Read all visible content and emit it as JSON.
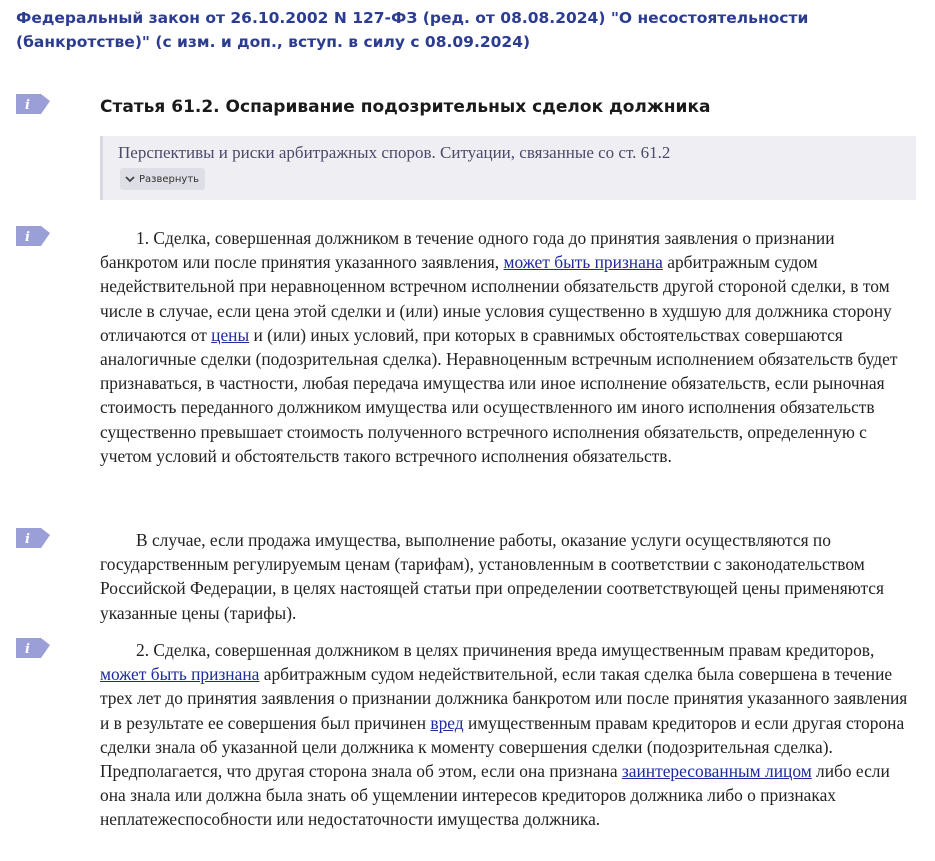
{
  "document": {
    "title": "Федеральный закон от 26.10.2002 N 127-ФЗ (ред. от 08.08.2024) \"О несостоятельности (банкротстве)\" (с изм. и доп., вступ. в силу с 08.09.2024)"
  },
  "colors": {
    "title": "#2b3c91",
    "link": "#1d2a9e",
    "icon": "#9b9fd8",
    "commentary_bg": "#efeff3"
  },
  "icons": {
    "paragraph_info": "info-icon",
    "expand": "chevron-down-icon"
  },
  "article": {
    "title": "Статья 61.2. Оспаривание подозрительных сделок должника"
  },
  "commentary": {
    "text": "Перспективы и риски арбитражных споров. Ситуации, связанные со ст. 61.2",
    "expand_label": "Развернуть"
  },
  "paragraphs": [
    {
      "t1": "1. Сделка, совершенная должником в течение одного года до принятия заявления о признании банкротом или после принятия указанного заявления, ",
      "link1": "может быть признана",
      "t2": " арбитражным судом недействительной при неравноценном встречном исполнении обязательств другой стороной сделки, в том числе в случае, если цена этой сделки и (или) иные условия существенно в худшую для должника сторону отличаются от ",
      "link2": "цены",
      "t3": " и (или) иных условий, при которых в сравнимых обстоятельствах совершаются аналогичные сделки (подозрительная сделка). Неравноценным встречным исполнением обязательств будет признаваться, в частности, любая передача имущества или иное исполнение обязательств, если рыночная стоимость переданного должником имущества или осуществленного им иного исполнения обязательств существенно превышает стоимость полученного встречного исполнения обязательств, определенную с учетом условий и обстоятельств такого встречного исполнения обязательств."
    },
    {
      "t1": "В случае, если продажа имущества, выполнение работы, оказание услуги осуществляются по государственным регулируемым ценам (тарифам), установленным в соответствии с законодательством Российской Федерации, в целях настоящей статьи при определении соответствующей цены применяются указанные цены (тарифы)."
    },
    {
      "t1": "2. Сделка, совершенная должником в целях причинения вреда имущественным правам кредиторов, ",
      "link1": "может быть признана",
      "t2": " арбитражным судом недействительной, если такая сделка была совершена в течение трех лет до принятия заявления о признании должника банкротом или после принятия указанного заявления и в результате ее совершения был причинен ",
      "link2": "вред",
      "t3": " имущественным правам кредиторов и если другая сторона сделки знала об указанной цели должника к моменту совершения сделки (подозрительная сделка). Предполагается, что другая сторона знала об этом, если она признана ",
      "link3": "заинтересованным лицом",
      "t4": " либо если она знала или должна была знать об ущемлении интересов кредиторов должника либо о признаках неплатежеспособности или недостаточности имущества должника."
    }
  ]
}
